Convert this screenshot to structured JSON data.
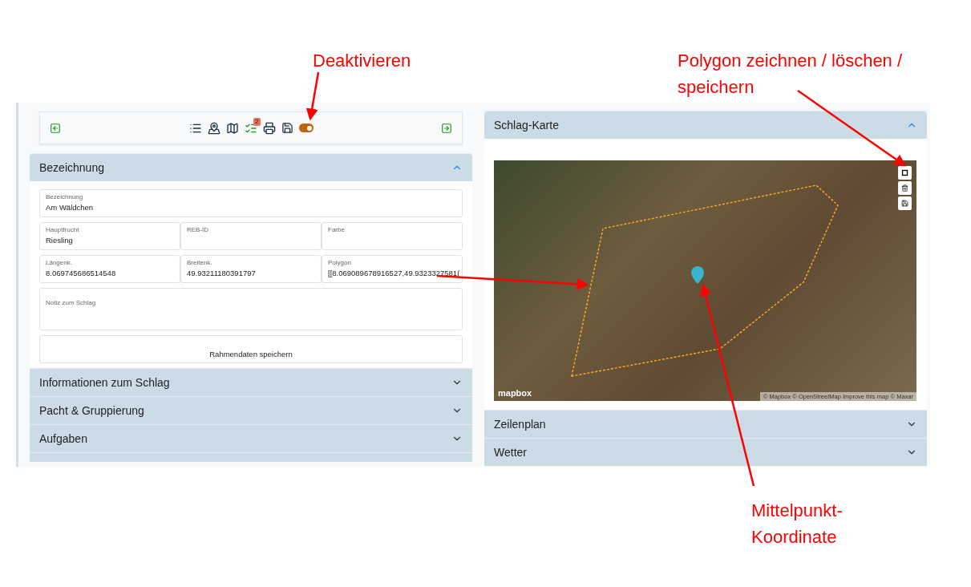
{
  "annotations": [
    {
      "text": "Deaktivieren"
    },
    {
      "text": "Polygon zeichnen / löschen / speichern"
    },
    {
      "text": "Mittelpunkt-Koordinate"
    }
  ],
  "toolbar": {
    "badge": "2",
    "toggle_on": true
  },
  "left_sections": [
    {
      "title": "Bezeichnung",
      "expanded": true
    },
    {
      "title": "Informationen zum Schlag",
      "expanded": false
    },
    {
      "title": "Pacht & Gruppierung",
      "expanded": false
    },
    {
      "title": "Aufgaben",
      "expanded": false
    }
  ],
  "form": {
    "rows": [
      [
        {
          "label": "Bezeichnung",
          "value": "Am Wäldchen"
        }
      ],
      [
        {
          "label": "Hauptfrucht",
          "value": "Riesling"
        },
        {
          "label": "REB-ID"
        },
        {
          "label": "Farbe"
        }
      ],
      [
        {
          "label": "Längenk.",
          "value": "8.069745686514548"
        },
        {
          "label": "Breitenk.",
          "value": "49.93211180391797"
        },
        {
          "label": "Polygon",
          "value": "[[8.069089678916527,49.9323327581("
        }
      ]
    ],
    "note_label": "Notiz zum Schlag",
    "save_button": "Rahmendaten speichern"
  },
  "right_sections": [
    {
      "title": "Schlag-Karte",
      "expanded": true
    },
    {
      "title": "Zeilenplan",
      "expanded": false
    },
    {
      "title": "Wetter",
      "expanded": false
    }
  ],
  "map": {
    "logo": "mapbox",
    "attribution": "© Mapbox © OpenStreetMap Improve this map © Maxar"
  }
}
